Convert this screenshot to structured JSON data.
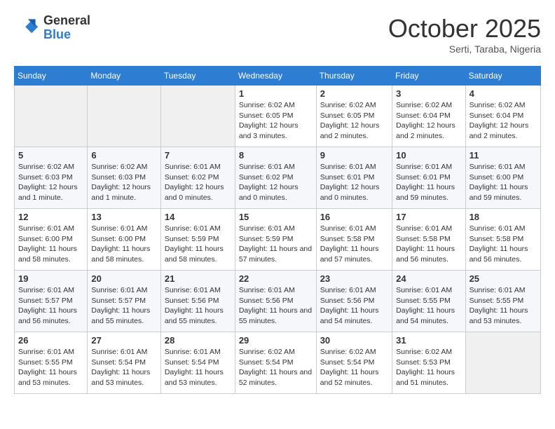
{
  "logo": {
    "general": "General",
    "blue": "Blue"
  },
  "title": "October 2025",
  "subtitle": "Serti, Taraba, Nigeria",
  "weekdays": [
    "Sunday",
    "Monday",
    "Tuesday",
    "Wednesday",
    "Thursday",
    "Friday",
    "Saturday"
  ],
  "weeks": [
    [
      {
        "day": "",
        "info": ""
      },
      {
        "day": "",
        "info": ""
      },
      {
        "day": "",
        "info": ""
      },
      {
        "day": "1",
        "info": "Sunrise: 6:02 AM\nSunset: 6:05 PM\nDaylight: 12 hours and 3 minutes."
      },
      {
        "day": "2",
        "info": "Sunrise: 6:02 AM\nSunset: 6:05 PM\nDaylight: 12 hours and 2 minutes."
      },
      {
        "day": "3",
        "info": "Sunrise: 6:02 AM\nSunset: 6:04 PM\nDaylight: 12 hours and 2 minutes."
      },
      {
        "day": "4",
        "info": "Sunrise: 6:02 AM\nSunset: 6:04 PM\nDaylight: 12 hours and 2 minutes."
      }
    ],
    [
      {
        "day": "5",
        "info": "Sunrise: 6:02 AM\nSunset: 6:03 PM\nDaylight: 12 hours and 1 minute."
      },
      {
        "day": "6",
        "info": "Sunrise: 6:02 AM\nSunset: 6:03 PM\nDaylight: 12 hours and 1 minute."
      },
      {
        "day": "7",
        "info": "Sunrise: 6:01 AM\nSunset: 6:02 PM\nDaylight: 12 hours and 0 minutes."
      },
      {
        "day": "8",
        "info": "Sunrise: 6:01 AM\nSunset: 6:02 PM\nDaylight: 12 hours and 0 minutes."
      },
      {
        "day": "9",
        "info": "Sunrise: 6:01 AM\nSunset: 6:01 PM\nDaylight: 12 hours and 0 minutes."
      },
      {
        "day": "10",
        "info": "Sunrise: 6:01 AM\nSunset: 6:01 PM\nDaylight: 11 hours and 59 minutes."
      },
      {
        "day": "11",
        "info": "Sunrise: 6:01 AM\nSunset: 6:00 PM\nDaylight: 11 hours and 59 minutes."
      }
    ],
    [
      {
        "day": "12",
        "info": "Sunrise: 6:01 AM\nSunset: 6:00 PM\nDaylight: 11 hours and 58 minutes."
      },
      {
        "day": "13",
        "info": "Sunrise: 6:01 AM\nSunset: 6:00 PM\nDaylight: 11 hours and 58 minutes."
      },
      {
        "day": "14",
        "info": "Sunrise: 6:01 AM\nSunset: 5:59 PM\nDaylight: 11 hours and 58 minutes."
      },
      {
        "day": "15",
        "info": "Sunrise: 6:01 AM\nSunset: 5:59 PM\nDaylight: 11 hours and 57 minutes."
      },
      {
        "day": "16",
        "info": "Sunrise: 6:01 AM\nSunset: 5:58 PM\nDaylight: 11 hours and 57 minutes."
      },
      {
        "day": "17",
        "info": "Sunrise: 6:01 AM\nSunset: 5:58 PM\nDaylight: 11 hours and 56 minutes."
      },
      {
        "day": "18",
        "info": "Sunrise: 6:01 AM\nSunset: 5:58 PM\nDaylight: 11 hours and 56 minutes."
      }
    ],
    [
      {
        "day": "19",
        "info": "Sunrise: 6:01 AM\nSunset: 5:57 PM\nDaylight: 11 hours and 56 minutes."
      },
      {
        "day": "20",
        "info": "Sunrise: 6:01 AM\nSunset: 5:57 PM\nDaylight: 11 hours and 55 minutes."
      },
      {
        "day": "21",
        "info": "Sunrise: 6:01 AM\nSunset: 5:56 PM\nDaylight: 11 hours and 55 minutes."
      },
      {
        "day": "22",
        "info": "Sunrise: 6:01 AM\nSunset: 5:56 PM\nDaylight: 11 hours and 55 minutes."
      },
      {
        "day": "23",
        "info": "Sunrise: 6:01 AM\nSunset: 5:56 PM\nDaylight: 11 hours and 54 minutes."
      },
      {
        "day": "24",
        "info": "Sunrise: 6:01 AM\nSunset: 5:55 PM\nDaylight: 11 hours and 54 minutes."
      },
      {
        "day": "25",
        "info": "Sunrise: 6:01 AM\nSunset: 5:55 PM\nDaylight: 11 hours and 53 minutes."
      }
    ],
    [
      {
        "day": "26",
        "info": "Sunrise: 6:01 AM\nSunset: 5:55 PM\nDaylight: 11 hours and 53 minutes."
      },
      {
        "day": "27",
        "info": "Sunrise: 6:01 AM\nSunset: 5:54 PM\nDaylight: 11 hours and 53 minutes."
      },
      {
        "day": "28",
        "info": "Sunrise: 6:01 AM\nSunset: 5:54 PM\nDaylight: 11 hours and 53 minutes."
      },
      {
        "day": "29",
        "info": "Sunrise: 6:02 AM\nSunset: 5:54 PM\nDaylight: 11 hours and 52 minutes."
      },
      {
        "day": "30",
        "info": "Sunrise: 6:02 AM\nSunset: 5:54 PM\nDaylight: 11 hours and 52 minutes."
      },
      {
        "day": "31",
        "info": "Sunrise: 6:02 AM\nSunset: 5:53 PM\nDaylight: 11 hours and 51 minutes."
      },
      {
        "day": "",
        "info": ""
      }
    ]
  ]
}
